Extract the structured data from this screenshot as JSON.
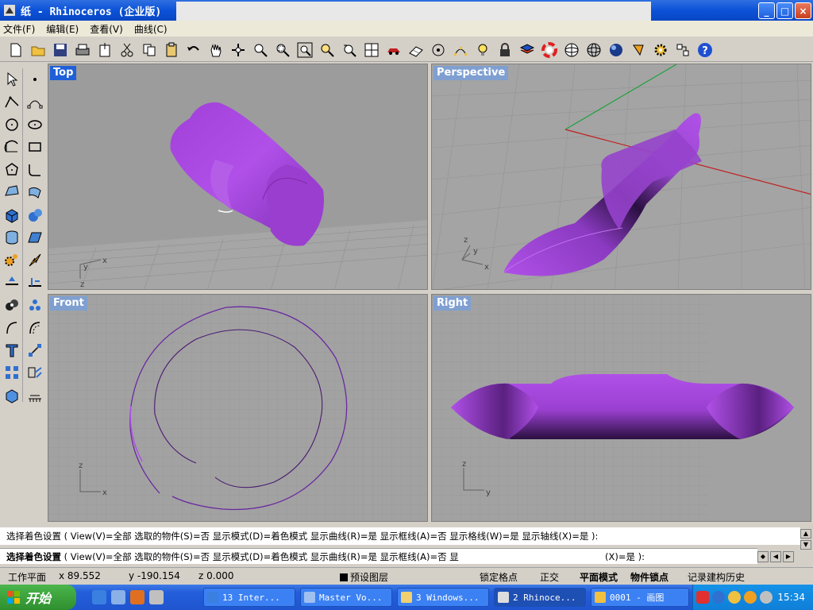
{
  "window": {
    "title": "纸 - Rhinoceros (企业版)",
    "controls": [
      "_",
      "□",
      "×"
    ]
  },
  "menu": [
    "文件(F)",
    "编辑(E)",
    "查看(V)",
    "曲线(C)"
  ],
  "viewports": {
    "top": "Top",
    "perspective": "Perspective",
    "front": "Front",
    "right": "Right"
  },
  "axes": {
    "top": {
      "a": "x",
      "b": "y",
      "c": "z"
    },
    "perspective": {
      "a": "z",
      "b": "y",
      "c": "x"
    },
    "front": {
      "a": "z",
      "b": "x"
    },
    "right": {
      "a": "z",
      "b": "y"
    }
  },
  "command": {
    "history_line": "选择着色设置 ( View(V)=全部  选取的物件(S)=否  显示模式(D)=着色模式  显示曲线(R)=是  显示框线(A)=否  显示格线(W)=是  显示轴线(X)=是 ):",
    "prompt_bold": "选择着色设置",
    "prompt_rest": " ( View(V)=全部  选取的物件(S)=否  显示模式(D)=着色模式  显示曲线(R)=是  显示框线(A)=否  显",
    "prompt_tail": "(X)=是 ):"
  },
  "status": {
    "plane": "工作平面",
    "x": "x 89.552",
    "y": "y -190.154",
    "z": "z 0.000",
    "layer": "预设图层",
    "grid_snap": "锁定格点",
    "ortho": "正交",
    "planar": "平面模式",
    "osnap": "物件锁点",
    "history": "记录建构历史"
  },
  "taskbar": {
    "start": "开始",
    "tasks": [
      "13 Inter...",
      "Master Vo...",
      "3 Windows...",
      "2 Rhinoce...",
      "0001 - 画图"
    ],
    "clock": "15:34"
  },
  "colors": {
    "surface": "#b050e8",
    "dark": "#2a1040",
    "grid": "#8a8a8a",
    "background": "#a0a0a0"
  }
}
